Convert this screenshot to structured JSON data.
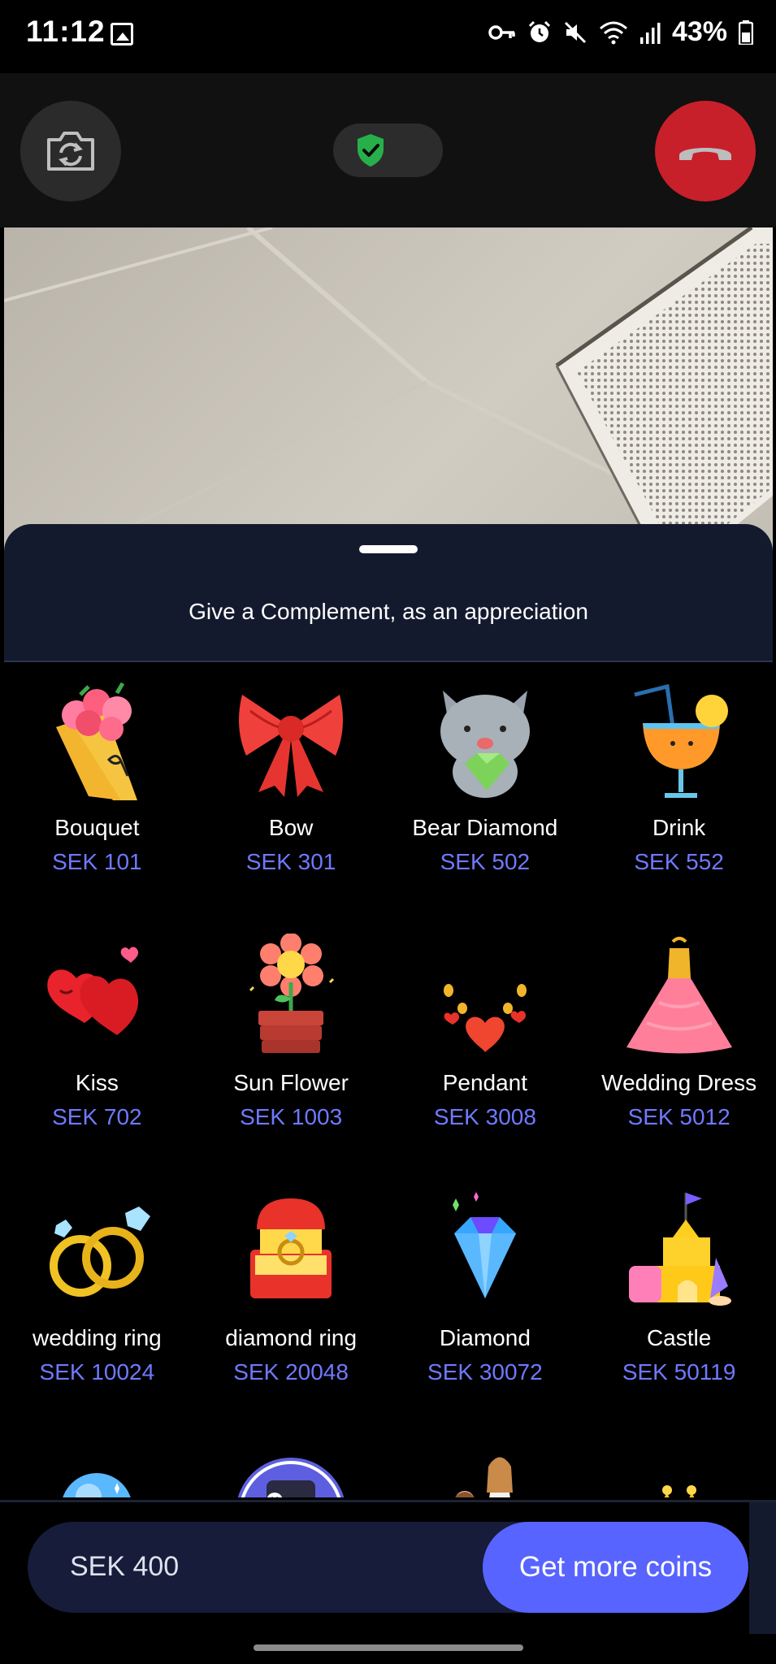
{
  "status_bar": {
    "time": "11:12",
    "battery_percent": "43%",
    "icons": [
      "image-icon",
      "vpn-key-icon",
      "alarm-icon",
      "mute-icon",
      "wifi-icon",
      "signal-icon",
      "battery-icon"
    ]
  },
  "call_controls": {
    "flip_camera_icon": "camera-flip-icon",
    "secure_icon": "shield-check-icon",
    "hangup_icon": "phone-hangup-icon",
    "hangup_color": "#c8202b",
    "secure_color": "#27b04a"
  },
  "sheet": {
    "title": "Give a Complement, as an appreciation"
  },
  "gifts": [
    {
      "name": "Bouquet",
      "price": "SEK 101",
      "icon": "bouquet-icon"
    },
    {
      "name": "Bow",
      "price": "SEK 301",
      "icon": "bow-icon"
    },
    {
      "name": "Bear Diamond",
      "price": "SEK 502",
      "icon": "bear-diamond-icon"
    },
    {
      "name": "Drink",
      "price": "SEK 552",
      "icon": "drink-icon"
    },
    {
      "name": "Kiss",
      "price": "SEK 702",
      "icon": "kiss-hearts-icon"
    },
    {
      "name": "Sun Flower",
      "price": "SEK 1003",
      "icon": "sunflower-icon"
    },
    {
      "name": "Pendant",
      "price": "SEK 3008",
      "icon": "pendant-icon"
    },
    {
      "name": "Wedding Dress",
      "price": "SEK 5012",
      "icon": "wedding-dress-icon"
    },
    {
      "name": "wedding ring",
      "price": "SEK 10024",
      "icon": "wedding-ring-icon"
    },
    {
      "name": "diamond ring",
      "price": "SEK 20048",
      "icon": "diamond-ring-icon"
    },
    {
      "name": "Diamond",
      "price": "SEK 30072",
      "icon": "diamond-icon"
    },
    {
      "name": "Castle",
      "price": "SEK 50119",
      "icon": "castle-icon"
    },
    {
      "name": "",
      "price": "",
      "icon": "crystal-ball-icon"
    },
    {
      "name": "",
      "price": "",
      "icon": "treasure-icon"
    },
    {
      "name": "",
      "price": "",
      "icon": "proposal-icon"
    },
    {
      "name": "",
      "price": "",
      "icon": "crown-icon"
    }
  ],
  "footer": {
    "balance": "SEK 400",
    "get_coins_label": "Get more coins",
    "accent_color": "#5864ff",
    "price_color": "#6f79ff"
  }
}
